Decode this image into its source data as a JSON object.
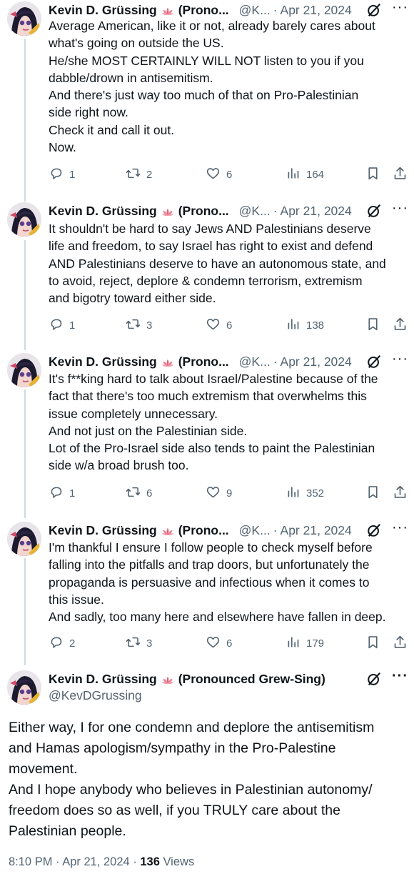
{
  "tweets": [
    {
      "name": "Kevin D. Grüssing",
      "name_suffix": "(Prono...",
      "handle": "@K...",
      "date": "Apr 21, 2024",
      "lines": [
        "Average American, like it or not, already barely cares about",
        "what's going on outside the US.",
        "He/she MOST CERTAINLY WILL NOT listen to you if you",
        "dabble/drown in antisemitism.",
        "And there's just way too much of that on Pro-Palestinian",
        "side right now.",
        "Check it and call it out.",
        "Now."
      ],
      "replies": "1",
      "reposts": "2",
      "likes": "6",
      "views": "164"
    },
    {
      "name": "Kevin D. Grüssing",
      "name_suffix": "(Prono...",
      "handle": "@K...",
      "date": "Apr 21, 2024",
      "lines": [
        "It shouldn't be hard to say Jews AND Palestinians deserve",
        "life and freedom, to say Israel has right to exist and defend",
        "AND Palestinians deserve to have an autonomous state, and",
        "to avoid, reject, deplore & condemn terrorism, extremism",
        "and bigotry toward either side."
      ],
      "replies": "1",
      "reposts": "3",
      "likes": "6",
      "views": "138"
    },
    {
      "name": "Kevin D. Grüssing",
      "name_suffix": "(Prono...",
      "handle": "@K...",
      "date": "Apr 21, 2024",
      "lines": [
        "It's f**king hard to talk about Israel/Palestine because of the",
        "fact that there's too much extremism that overwhelms this",
        "issue completely unnecessary.",
        "And not just on the Palestinian side.",
        "Lot of the Pro-Israel side also tends to paint the Palestinian",
        "side w/a broad brush too."
      ],
      "replies": "1",
      "reposts": "6",
      "likes": "9",
      "views": "352"
    },
    {
      "name": "Kevin D. Grüssing",
      "name_suffix": "(Prono...",
      "handle": "@K...",
      "date": "Apr 21, 2024",
      "lines": [
        "I'm thankful I ensure I follow people to check myself before",
        "falling into the pitfalls and trap doors, but unfortunately the",
        "propaganda is persuasive and infectious when it comes to",
        "this issue.",
        "And sadly, too many here and elsewhere have fallen in deep."
      ],
      "replies": "2",
      "reposts": "3",
      "likes": "6",
      "views": "179"
    }
  ],
  "main": {
    "name": "Kevin D. Grüssing",
    "name_suffix": "(Pronounced Grew-Sing)",
    "handle": "@KevDGrussing",
    "lines": [
      "Either way, I for one condemn and deplore the antisemitism",
      "and Hamas apologism/sympathy in the Pro-Palestine",
      "movement.",
      "And I hope anybody who believes in Palestinian autonomy/",
      "freedom does so as well, if you TRULY care about the",
      "Palestinian people."
    ],
    "time": "8:10 PM · Apr 21, 2024 · ",
    "views_count": "136",
    "views_label": " Views"
  },
  "dot_separator": "·",
  "more_glyph": "···",
  "icons": {
    "reply": "reply-icon",
    "repost": "repost-icon",
    "like": "like-icon",
    "views": "views-icon",
    "bookmark": "bookmark-icon",
    "share": "share-icon",
    "grok": "grok-icon",
    "more": "more-icon",
    "flower": "lotus-emoji-icon"
  },
  "colors": {
    "muted": "#536471",
    "text": "#0f1419",
    "thread_line": "#cfd9de",
    "flower": "#e0667a"
  }
}
